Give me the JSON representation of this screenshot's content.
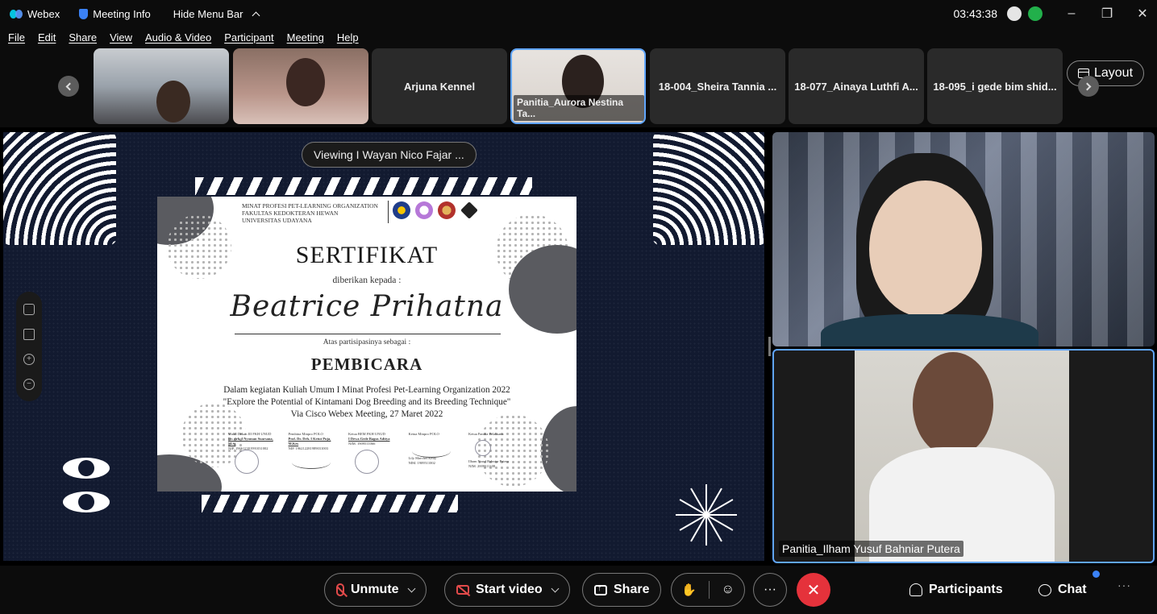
{
  "titlebar": {
    "app_name": "Webex",
    "meeting_info": "Meeting Info",
    "hide_menu_bar": "Hide Menu Bar",
    "clock": "03:43:38",
    "minimize": "–",
    "restore": "❐",
    "close": "✕"
  },
  "menu": {
    "items": [
      "File",
      "Edit",
      "Share",
      "View",
      "Audio & Video",
      "Participant",
      "Meeting",
      "Help"
    ]
  },
  "strip": {
    "thumbnails": [
      {
        "name": "",
        "type": "video"
      },
      {
        "name": "",
        "type": "video"
      },
      {
        "name": "Arjuna Kennel",
        "type": "name"
      },
      {
        "name": "Panitia_Aurora Nestina Ta...",
        "type": "video-active"
      },
      {
        "name": "18-004_Sheira Tannia ...",
        "type": "name"
      },
      {
        "name": "18-077_Ainaya Luthfi A...",
        "type": "name"
      },
      {
        "name": "18-095_i gede bim shid...",
        "type": "name"
      }
    ],
    "layout_label": "Layout"
  },
  "share": {
    "viewing_label": "Viewing I Wayan Nico Fajar ...",
    "certificate": {
      "org_line1": "Minat Profesi Pet-Learning Organization",
      "org_line2": "Fakultas Kedokteran Hewan",
      "org_line3": "Universitas Udayana",
      "title": "SERTIFIKAT",
      "given_to": "diberikan kepada :",
      "recipient": "Beatrice Prihatna",
      "participation": "Atas partisipasinya sebagai :",
      "role": "PEMBICARA",
      "desc1": "Dalam kegiatan Kuliah Umum I Minat Profesi Pet-Learning Organization 2022",
      "desc2": "\"Explore the Potential of Kintamani Dog Breeding and its Breeding Technique\"",
      "desc3": "Via Cisco Webex Meeting, 27 Maret 2022",
      "signatures": [
        {
          "role": "Wakil Dekan III FKH UNUD",
          "name": "Dr. drh. I Nyoman Suarsana, M.Si",
          "id": "NIP. 196612301991031002"
        },
        {
          "role": "Pembina Minpro POLO",
          "name": "Prof. Dr. Drh. I Ketut Puja, M.Kes",
          "id": "NIP. 196212281989031003"
        },
        {
          "role": "Ketua BEM FKH UNUD",
          "name": "I Dewa Gede Bagus Aditya",
          "id": "NIM. 1909511066"
        },
        {
          "role": "Ketua Minpro POLO",
          "name": "Lily Marchel Kelly",
          "id": "NIM. 1909511002"
        },
        {
          "role": "Ketua Panitia Pelaksana",
          "name": "Ilham Yusuf Bahniar Putera",
          "id": "NIM. 2009511108"
        }
      ]
    }
  },
  "videos": {
    "top_name": "",
    "bottom_name": "Panitia_Ilham Yusuf Bahniar Putera"
  },
  "controls": {
    "unmute": "Unmute",
    "start_video": "Start video",
    "share": "Share",
    "end_symbol": "✕",
    "more": "···",
    "participants": "Participants",
    "chat": "Chat",
    "more_right": "···"
  }
}
